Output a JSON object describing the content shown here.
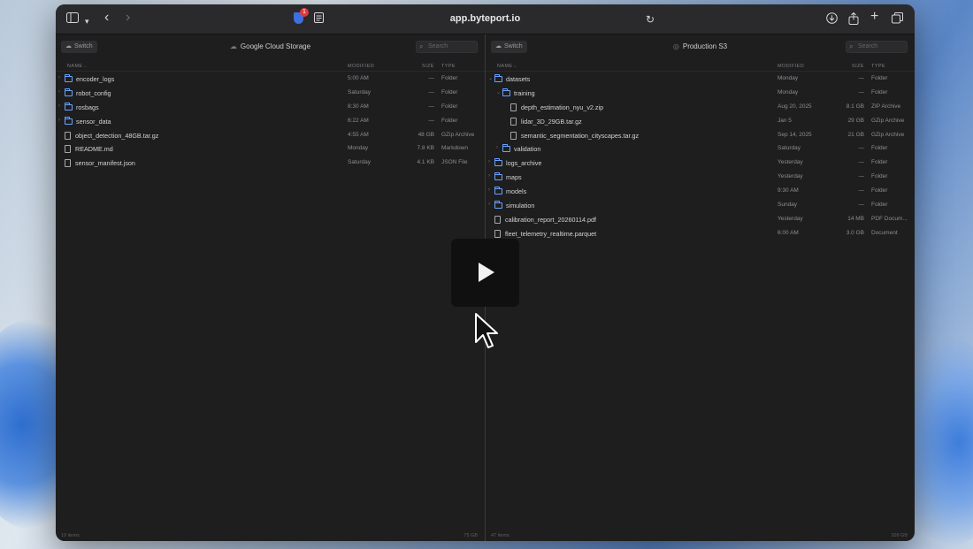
{
  "browser": {
    "url": "app.byteport.io",
    "extension_badge": "1"
  },
  "left_pane": {
    "switch_label": "Switch",
    "title": "Google Cloud Storage",
    "search_placeholder": "Search",
    "columns": {
      "name": "NAME",
      "modified": "MODIFIED",
      "size": "SIZE",
      "type": "TYPE"
    },
    "rows": [
      {
        "kind": "folder",
        "name": "encoder_logs",
        "modified": "5:00 AM",
        "size": "—",
        "type": "Folder"
      },
      {
        "kind": "folder",
        "name": "robot_config",
        "modified": "Saturday",
        "size": "—",
        "type": "Folder"
      },
      {
        "kind": "folder",
        "name": "rosbags",
        "modified": "8:30 AM",
        "size": "—",
        "type": "Folder"
      },
      {
        "kind": "folder",
        "name": "sensor_data",
        "modified": "6:22 AM",
        "size": "—",
        "type": "Folder"
      },
      {
        "kind": "file",
        "name": "object_detection_48GB.tar.gz",
        "modified": "4:55 AM",
        "size": "48 GB",
        "type": "GZip Archive"
      },
      {
        "kind": "file",
        "name": "README.md",
        "modified": "Monday",
        "size": "7.8 KB",
        "type": "Markdown"
      },
      {
        "kind": "file",
        "name": "sensor_manifest.json",
        "modified": "Saturday",
        "size": "4.1 KB",
        "type": "JSON File"
      }
    ],
    "status_left": "19 items",
    "status_right": "75 GB"
  },
  "right_pane": {
    "switch_label": "Switch",
    "title": "Production S3",
    "search_placeholder": "Search",
    "columns": {
      "name": "NAME",
      "modified": "MODIFIED",
      "size": "SIZE",
      "type": "TYPE"
    },
    "rows": [
      {
        "kind": "folder",
        "depth": 0,
        "expanded": true,
        "name": "datasets",
        "modified": "Monday",
        "size": "—",
        "type": "Folder"
      },
      {
        "kind": "folder",
        "depth": 1,
        "expanded": true,
        "name": "training",
        "modified": "Monday",
        "size": "—",
        "type": "Folder"
      },
      {
        "kind": "file",
        "depth": 2,
        "name": "depth_estimation_nyu_v2.zip",
        "modified": "Aug 20, 2025",
        "size": "8.1 GB",
        "type": "ZIP Archive"
      },
      {
        "kind": "file",
        "depth": 2,
        "name": "lidar_3D_29GB.tar.gz",
        "modified": "Jan 5",
        "size": "29 GB",
        "type": "GZip Archive"
      },
      {
        "kind": "file",
        "depth": 2,
        "name": "semantic_segmentation_cityscapes.tar.gz",
        "modified": "Sep 14, 2025",
        "size": "21 GB",
        "type": "GZip Archive"
      },
      {
        "kind": "folder",
        "depth": 1,
        "expanded": false,
        "name": "validation",
        "modified": "Saturday",
        "size": "—",
        "type": "Folder"
      },
      {
        "kind": "folder",
        "depth": 0,
        "expanded": false,
        "name": "logs_archive",
        "modified": "Yesterday",
        "size": "—",
        "type": "Folder"
      },
      {
        "kind": "folder",
        "depth": 0,
        "expanded": false,
        "name": "maps",
        "modified": "Yesterday",
        "size": "—",
        "type": "Folder"
      },
      {
        "kind": "folder",
        "depth": 0,
        "expanded": false,
        "name": "models",
        "modified": "9:30 AM",
        "size": "—",
        "type": "Folder"
      },
      {
        "kind": "folder",
        "depth": 0,
        "expanded": false,
        "name": "simulation",
        "modified": "Sunday",
        "size": "—",
        "type": "Folder"
      },
      {
        "kind": "file",
        "depth": 0,
        "name": "calibration_report_20260114.pdf",
        "modified": "Yesterday",
        "size": "14 MB",
        "type": "PDF Docum..."
      },
      {
        "kind": "file",
        "depth": 0,
        "name": "fleet_telemetry_realtime.parquet",
        "modified": "6:00 AM",
        "size": "3.0 GB",
        "type": "Document"
      }
    ],
    "status_left": "47 items",
    "status_right": "109 GB"
  },
  "video": {
    "play_icon": "play-icon",
    "cursor_icon": "pointer-cursor-icon"
  }
}
